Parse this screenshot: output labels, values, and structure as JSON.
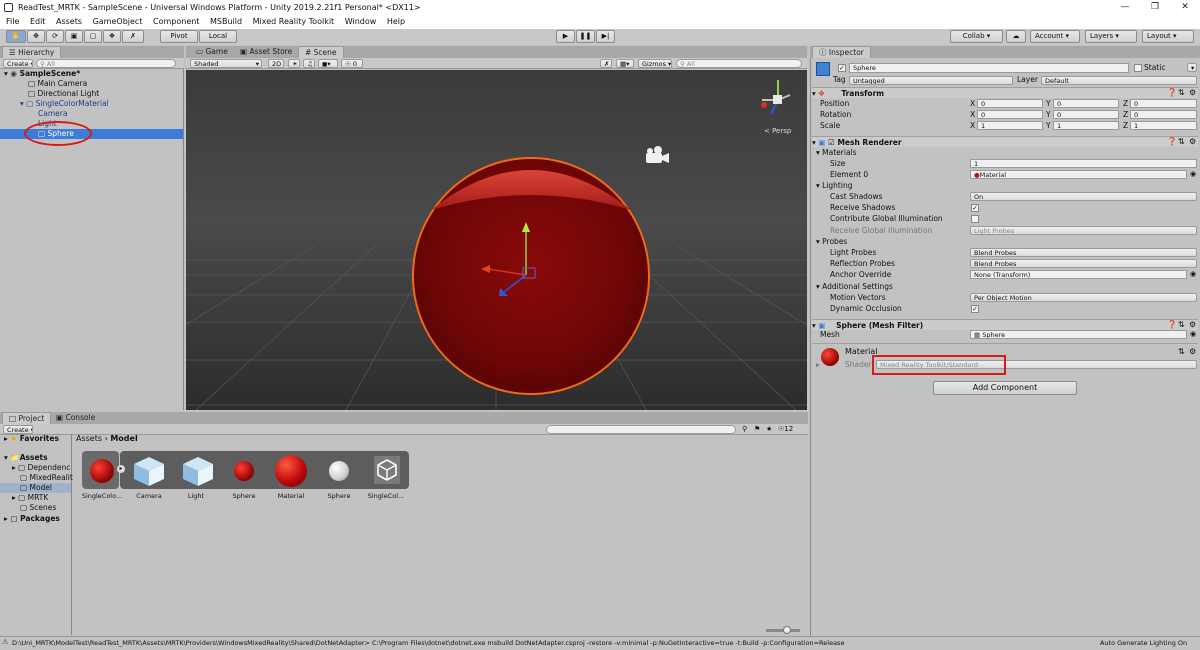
{
  "window": {
    "title": "ReadTest_MRTK - SampleScene - Universal Windows Platform - Unity 2019.2.21f1 Personal* <DX11>"
  },
  "menu": [
    "File",
    "Edit",
    "Assets",
    "GameObject",
    "Component",
    "MSBuild",
    "Mixed Reality Toolkit",
    "Window",
    "Help"
  ],
  "toolbar": {
    "pivot": "Pivot",
    "local": "Local",
    "collab": "Collab ▾",
    "account": "Account",
    "layers": "Layers",
    "layout": "Layout"
  },
  "hierarchy": {
    "tab": "Hierarchy",
    "create": "Create ▾",
    "search_placeholder": "All",
    "scene": "SampleScene*",
    "items": [
      "Main Camera",
      "Directional Light",
      "SingleColorMaterial",
      "Camera",
      "Light",
      "Sphere"
    ]
  },
  "scene": {
    "tabs": [
      "Game",
      "Asset Store",
      "Scene"
    ],
    "shading": "Shaded",
    "mode2d": "2D",
    "gizmos": "Gizmos ▾",
    "search_placeholder": "All",
    "fx_count": "0",
    "persp": "< Persp"
  },
  "inspector": {
    "tab": "Inspector",
    "object_name": "Sphere",
    "static_label": "Static",
    "tag_label": "Tag",
    "tag_value": "Untagged",
    "layer_label": "Layer",
    "layer_value": "Default",
    "transform": {
      "title": "Transform",
      "position_label": "Position",
      "rotation_label": "Rotation",
      "scale_label": "Scale",
      "axis_x": "X",
      "axis_y": "Y",
      "axis_z": "Z",
      "position": [
        "0",
        "0",
        "0"
      ],
      "rotation": [
        "0",
        "0",
        "0"
      ],
      "scale": [
        "1",
        "1",
        "1"
      ]
    },
    "mesh_renderer": {
      "title": "Mesh Renderer",
      "materials": "Materials",
      "size_label": "Size",
      "size_value": "1",
      "element0_label": "Element 0",
      "element0_value": "Material",
      "lighting": "Lighting",
      "cast_shadows_label": "Cast Shadows",
      "cast_shadows_value": "On",
      "receive_shadows_label": "Receive Shadows",
      "contribute_gi_label": "Contribute Global Illumination",
      "receive_gi_label": "Receive Global Illumination",
      "receive_gi_value": "Light Probes",
      "probes": "Probes",
      "light_probes_label": "Light Probes",
      "light_probes_value": "Blend Probes",
      "reflection_probes_label": "Reflection Probes",
      "reflection_probes_value": "Blend Probes",
      "anchor_override_label": "Anchor Override",
      "anchor_override_value": "None (Transform)",
      "additional": "Additional Settings",
      "motion_vectors_label": "Motion Vectors",
      "motion_vectors_value": "Per Object Motion",
      "dynamic_occlusion_label": "Dynamic Occlusion"
    },
    "mesh_filter": {
      "title": "Sphere (Mesh Filter)",
      "mesh_label": "Mesh",
      "mesh_value": "Sphere"
    },
    "material": {
      "name": "Material",
      "shader_label": "Shader",
      "shader_value": "Mixed Reality Toolkit/Standard"
    },
    "add_component": "Add Component"
  },
  "project": {
    "tabs": [
      "Project",
      "Console"
    ],
    "create": "Create ▾",
    "favorites": "Favorites",
    "assets": "Assets",
    "folders": [
      "Dependenc",
      "MixedRealit",
      "Model",
      "MRTK",
      "Scenes"
    ],
    "packages": "Packages",
    "breadcrumb_root": "Assets",
    "breadcrumb_sep": "›",
    "breadcrumb_current": "Model",
    "hidden_count": "12",
    "items": [
      {
        "label": "SingleColo...",
        "type": "red-sphere"
      },
      {
        "label": "Camera",
        "type": "cube"
      },
      {
        "label": "Light",
        "type": "cube"
      },
      {
        "label": "Sphere",
        "type": "small-red-sphere"
      },
      {
        "label": "Material",
        "type": "red-sphere"
      },
      {
        "label": "Sphere",
        "type": "white-sphere"
      },
      {
        "label": "SingleCol...",
        "type": "unity-logo"
      }
    ]
  },
  "status": {
    "message": "D:\\Uni_MRTK\\ModelTest\\ReadTest_MRTK\\Assets\\MRTK\\Providers\\WindowsMixedReality\\Shared\\DotNetAdapter> C:\\Program Files\\dotnet\\dotnet.exe msbuild DotNetAdapter.csproj -restore  -v:minimal -p:NuGetInteractive=true  -t:Build -p:Configuration=Release",
    "right": "Auto Generate Lighting On"
  },
  "colors": {
    "accent_red": "#d81a1a",
    "sphere": "#8d0c0c",
    "selection": "#3d7bd8",
    "scene_bg": "#404040"
  }
}
